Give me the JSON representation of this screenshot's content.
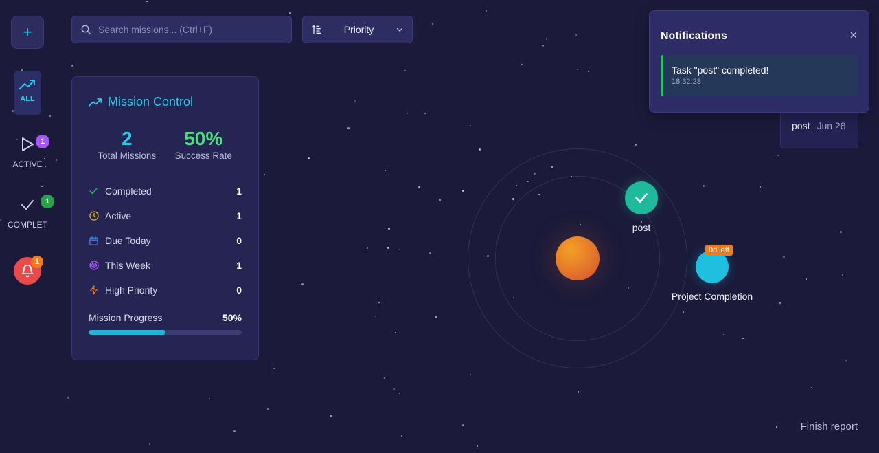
{
  "sidebar": {
    "add_icon": "plus-icon",
    "items": [
      {
        "label": "ALL",
        "icon": "trending-up-icon"
      },
      {
        "label": "ACTIVE",
        "icon": "play-icon",
        "badge": "1",
        "badge_color": "#a855f7"
      },
      {
        "label": "COMPLET",
        "icon": "check-icon",
        "badge": "1",
        "badge_color": "#22a447"
      }
    ],
    "bell": {
      "icon": "bell-icon",
      "badge": "1",
      "color": "#e94b4b",
      "badge_color": "#f07a1c"
    }
  },
  "search": {
    "placeholder": "Search missions... (Ctrl+F)",
    "value": ""
  },
  "sort": {
    "label": "Priority"
  },
  "mission_control": {
    "title": "Mission Control",
    "total_missions": "2",
    "total_missions_label": "Total Missions",
    "success_rate": "50%",
    "success_rate_label": "Success Rate",
    "rows": [
      {
        "label": "Completed",
        "value": "1",
        "icon": "check-icon",
        "color": "#22c55e"
      },
      {
        "label": "Active",
        "value": "1",
        "icon": "clock-icon",
        "color": "#eab308"
      },
      {
        "label": "Due Today",
        "value": "0",
        "icon": "calendar-icon",
        "color": "#3b82f6"
      },
      {
        "label": "This Week",
        "value": "1",
        "icon": "target-icon",
        "color": "#a855f7"
      },
      {
        "label": "High Priority",
        "value": "0",
        "icon": "bolt-icon",
        "color": "#f97316"
      }
    ],
    "progress_label": "Mission Progress",
    "progress_value": "50%",
    "progress_fraction": 0.5
  },
  "orbit": {
    "completed_task": {
      "label": "post",
      "icon": "check-icon"
    },
    "pending_task": {
      "label": "Project Completion",
      "badge": "0d left"
    }
  },
  "task_card": {
    "title": "post",
    "date": "Jun 28"
  },
  "notifications": {
    "title": "Notifications",
    "items": [
      {
        "message": "Task \"post\" completed!",
        "time": "18:32:23"
      }
    ]
  },
  "footer": {
    "text": "Finish report"
  },
  "colors": {
    "accent": "#2ec7e6",
    "success": "#4ade80",
    "background": "#1b1a3a"
  }
}
